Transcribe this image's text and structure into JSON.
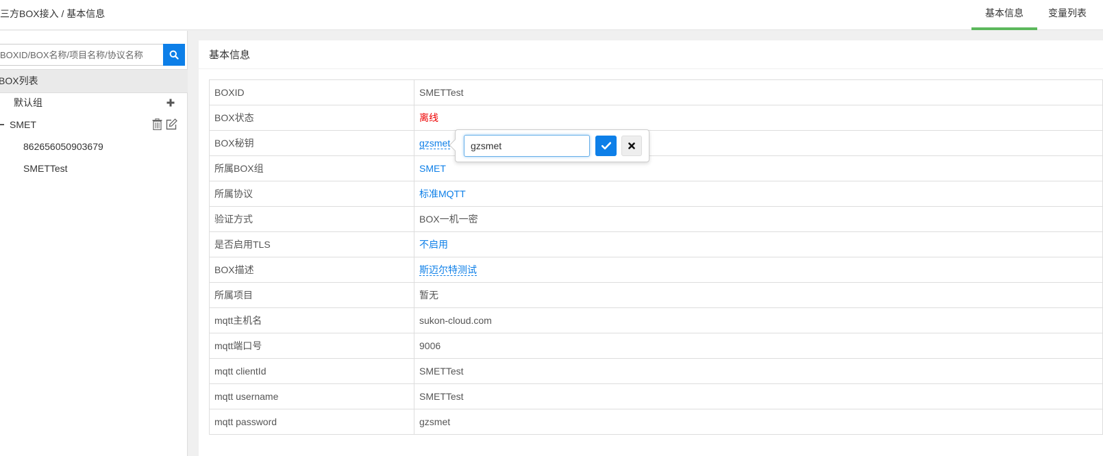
{
  "header": {
    "breadcrumb": "三方BOX接入 / 基本信息",
    "tabs": [
      {
        "label": "基本信息",
        "active": true
      },
      {
        "label": "变量列表",
        "active": false
      }
    ],
    "active_tab_color": "#5cb85c"
  },
  "sidebar": {
    "search_placeholder": "BOXID/BOX名称/项目名称/协议名称",
    "search_icon": "search-icon",
    "tree_title": "BOX列表",
    "groups": [
      {
        "label": "默认组",
        "icons": [
          "plus-icon"
        ]
      },
      {
        "label": "SMET",
        "expanded": true,
        "icons": [
          "trash-icon",
          "edit-icon"
        ],
        "children": [
          "862656050903679",
          "SMETTest"
        ]
      }
    ]
  },
  "main": {
    "title": "基本信息",
    "rows": [
      {
        "key": "BOXID",
        "value": "SMETTest"
      },
      {
        "key": "BOX状态",
        "value": "离线"
      },
      {
        "key": "BOX秘钥",
        "value": "gzsmet"
      },
      {
        "key": "所属BOX组",
        "value": "SMET"
      },
      {
        "key": "所属协议",
        "value": "标准MQTT"
      },
      {
        "key": "验证方式",
        "value": "BOX一机一密"
      },
      {
        "key": "是否启用TLS",
        "value": "不启用"
      },
      {
        "key": "BOX描述",
        "value": "斯迈尔特测试"
      },
      {
        "key": "所属项目",
        "value": "暂无"
      },
      {
        "key": "mqtt主机名",
        "value": "sukon-cloud.com"
      },
      {
        "key": "mqtt端口号",
        "value": "9006"
      },
      {
        "key": "mqtt clientId",
        "value": "SMETTest"
      },
      {
        "key": "mqtt username",
        "value": "SMETTest"
      },
      {
        "key": "mqtt password",
        "value": "gzsmet"
      }
    ]
  },
  "popover": {
    "input_value": "gzsmet",
    "confirm_icon": "check-icon",
    "cancel_icon": "close-icon"
  },
  "colors": {
    "primary": "#0d7fe8",
    "offline": "#e00000"
  }
}
